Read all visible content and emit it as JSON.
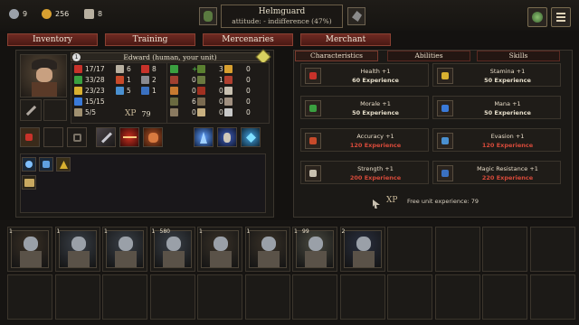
{
  "resources": {
    "units": "9",
    "gold": "256",
    "population": "8"
  },
  "header": {
    "title": "Helmguard",
    "attitude": "attitude: - indifference (47%)"
  },
  "tabs": [
    "Inventory",
    "Training",
    "Mercenaries",
    "Merchant"
  ],
  "unit": {
    "level": "1",
    "name": "Edward (human, your unit)",
    "health": "17/17",
    "morale": "33/28",
    "accuracy": "23/23",
    "mana": "15/15",
    "moves": "5/5",
    "stat_a": "6",
    "stat_b": "1",
    "stat_c": "5",
    "stat_d": "8",
    "stat_e": "2",
    "stat_f": "1",
    "xp_label": "XP",
    "xp": "79",
    "resists_col1": [
      "+5",
      "0",
      "0",
      "6",
      "0"
    ],
    "resists_col2": [
      "3",
      "1",
      "0",
      "0",
      "0"
    ],
    "resists_col3": [
      "0",
      "0",
      "0",
      "0",
      "0"
    ]
  },
  "subtabs": [
    "Characteristics",
    "Abilities",
    "Skills"
  ],
  "upgrades": [
    {
      "name": "Health +1",
      "exp": "60 Experience",
      "affordable": true,
      "icon": "heart-icon",
      "color": "#c8322a"
    },
    {
      "name": "Stamina +1",
      "exp": "50 Experience",
      "affordable": true,
      "icon": "lightning-icon",
      "color": "#d8b030"
    },
    {
      "name": "Morale +1",
      "exp": "50 Experience",
      "affordable": true,
      "icon": "flag-icon",
      "color": "#3aa040"
    },
    {
      "name": "Mana +1",
      "exp": "50 Experience",
      "affordable": true,
      "icon": "mana-icon",
      "color": "#3a7ad8"
    },
    {
      "name": "Accuracy +1",
      "exp": "120 Experience",
      "affordable": false,
      "icon": "target-icon",
      "color": "#c84a2a"
    },
    {
      "name": "Evasion +1",
      "exp": "120 Experience",
      "affordable": false,
      "icon": "evasion-icon",
      "color": "#4a90d0"
    },
    {
      "name": "Strength +1",
      "exp": "200 Experience",
      "affordable": false,
      "icon": "sword-icon",
      "color": "#c8c0b0"
    },
    {
      "name": "Magic Resistance +1",
      "exp": "220 Experience",
      "affordable": false,
      "icon": "shield-icon",
      "color": "#3a70c0"
    }
  ],
  "free_xp": {
    "label": "XP",
    "text": "Free unit experience: 79"
  },
  "roster": [
    {
      "lvl": "1",
      "count": "",
      "color": "#3a3025"
    },
    {
      "lvl": "1",
      "count": "",
      "color": "#3a4048"
    },
    {
      "lvl": "1",
      "count": "",
      "color": "#3a4048"
    },
    {
      "lvl": "1",
      "count": "580",
      "color": "#3a4048"
    },
    {
      "lvl": "1",
      "count": "",
      "color": "#3a3228"
    },
    {
      "lvl": "1",
      "count": "",
      "color": "#3a3228"
    },
    {
      "lvl": "1",
      "count": "99",
      "color": "#4a4a40"
    },
    {
      "lvl": "2",
      "count": "",
      "color": "#2a3040"
    }
  ]
}
